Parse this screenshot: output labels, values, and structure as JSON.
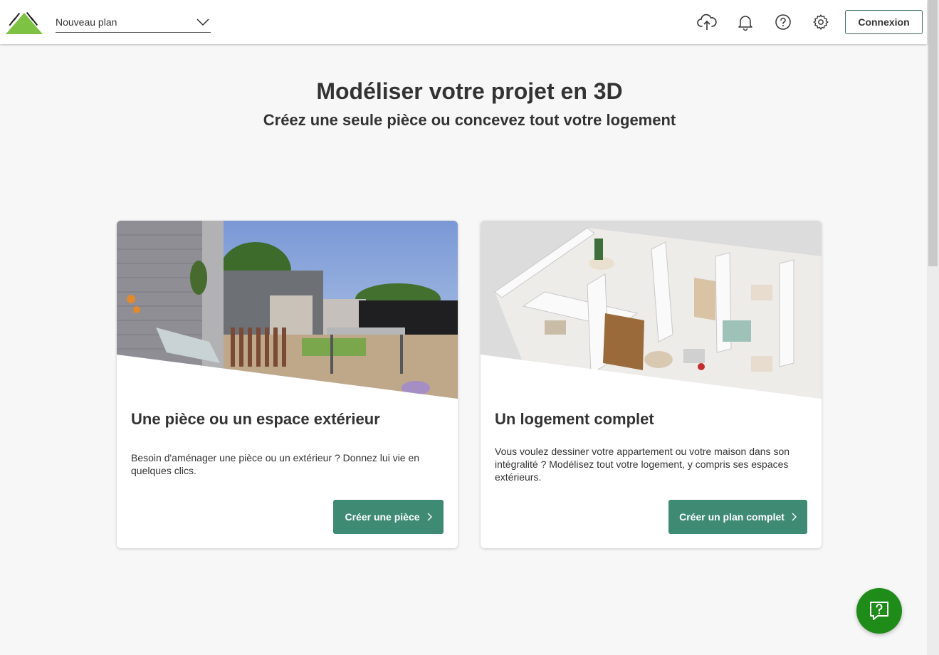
{
  "header": {
    "plan_select_value": "Nouveau plan",
    "login_label": "Connexion",
    "icons": [
      "cloud-upload-icon",
      "bell-icon",
      "help-circle-icon",
      "gear-icon"
    ]
  },
  "main": {
    "title": "Modéliser votre projet en 3D",
    "subtitle": "Créez une seule pièce ou concevez tout votre logement"
  },
  "cards": [
    {
      "title": "Une pièce ou un espace extérieur",
      "description": "Besoin d'aménager une pièce ou un extérieur ? Donnez lui vie en quelques clics.",
      "button_label": "Créer une pièce",
      "image": "garden-terrace-render"
    },
    {
      "title": "Un logement complet",
      "description": "Vous voulez dessiner votre appartement ou votre maison dans son intégralité ? Modélisez tout votre logement, y compris ses espaces extérieurs.",
      "button_label": "Créer un plan complet",
      "image": "apartment-3d-floorplan-render"
    }
  ],
  "colors": {
    "brand_green": "#7dc242",
    "button_green": "#3e8a73",
    "help_fab": "#1f8c1a",
    "login_border": "#3c6e5d"
  }
}
